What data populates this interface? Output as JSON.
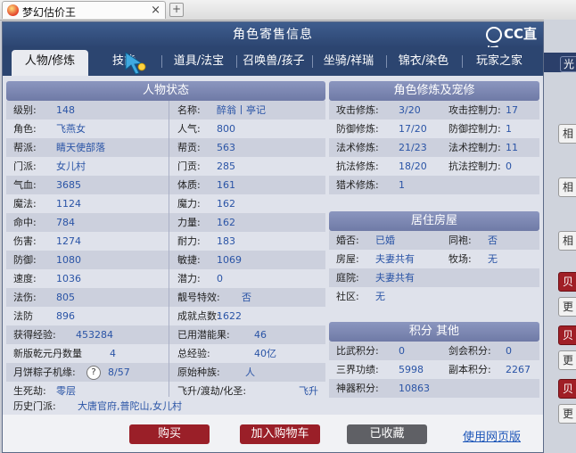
{
  "browser": {
    "tab_title": "梦幻估价王",
    "close": "×",
    "newtab": "+"
  },
  "dialog": {
    "title": "角色寄售信息",
    "logo": "CC直播"
  },
  "tabs": [
    "人物/修炼",
    "技能",
    "道具/法宝",
    "召唤兽/孩子",
    "坐骑/祥瑞",
    "锦衣/染色",
    "玩家之家"
  ],
  "sections": {
    "status": "人物状态",
    "cultivation": "角色修炼及宠修",
    "housing": "居住房屋",
    "points": "积分 其他"
  },
  "left_rows": [
    {
      "l1": "级别:",
      "v1": "148",
      "l2": "名称:",
      "v2": "醉翁丨亭记"
    },
    {
      "l1": "角色:",
      "v1": "飞燕女",
      "l2": "人气:",
      "v2": "800"
    },
    {
      "l1": "帮派:",
      "v1": "睛天使部落",
      "l2": "帮贡:",
      "v2": "563"
    },
    {
      "l1": "门派:",
      "v1": "女儿村",
      "l2": "门贡:",
      "v2": "285"
    },
    {
      "l1": "气血:",
      "v1": "3685",
      "l2": "体质:",
      "v2": "161"
    },
    {
      "l1": "魔法:",
      "v1": "1124",
      "l2": "魔力:",
      "v2": "162"
    },
    {
      "l1": "命中:",
      "v1": "784",
      "l2": "力量:",
      "v2": "162"
    },
    {
      "l1": "伤害:",
      "v1": "1274",
      "l2": "耐力:",
      "v2": "183"
    },
    {
      "l1": "防御:",
      "v1": "1080",
      "l2": "敏捷:",
      "v2": "1069"
    },
    {
      "l1": "速度:",
      "v1": "1036",
      "l2": "潜力:",
      "v2": "0"
    },
    {
      "l1": "法伤:",
      "v1": "805",
      "l2": "靓号特效:",
      "v2": "否"
    },
    {
      "l1": "法防",
      "v1": "896",
      "l2": "成就点数:",
      "v2": "1622"
    },
    {
      "l1": "获得经验:",
      "v1": "453284",
      "l2": "已用潜能果:",
      "v2": "46"
    },
    {
      "l1": "新版乾元丹数量",
      "v1": "4",
      "l2": "总经验:",
      "v2": "40亿"
    },
    {
      "l1": "月饼粽子机缘:",
      "v1": "8/57",
      "l2": "原始种族:",
      "v2": "人",
      "help": "?"
    },
    {
      "l1": "生死劫:",
      "v1": "零层",
      "l2": "飞升/渡劫/化圣:",
      "v2": "飞升"
    }
  ],
  "history": {
    "label": "历史门派:",
    "value": "大唐官府,普陀山,女儿村"
  },
  "cultivation_rows": [
    {
      "l1": "攻击修炼:",
      "v1": "3/20",
      "l2": "攻击控制力:",
      "v2": "17"
    },
    {
      "l1": "防御修炼:",
      "v1": "17/20",
      "l2": "防御控制力:",
      "v2": "1"
    },
    {
      "l1": "法术修炼:",
      "v1": "21/23",
      "l2": "法术控制力:",
      "v2": "11"
    },
    {
      "l1": "抗法修炼:",
      "v1": "18/20",
      "l2": "抗法控制力:",
      "v2": "0"
    },
    {
      "l1": "猎术修炼:",
      "v1": "1",
      "l2": "",
      "v2": ""
    }
  ],
  "housing_rows": [
    {
      "l1": "婚否:",
      "v1": "已婚",
      "l2": "同袍:",
      "v2": "否"
    },
    {
      "l1": "房屋:",
      "v1": "夫妻共有",
      "l2": "牧场:",
      "v2": "无"
    },
    {
      "l1": "庭院:",
      "v1": "夫妻共有",
      "l2": "",
      "v2": ""
    },
    {
      "l1": "社区:",
      "v1": "无",
      "l2": "",
      "v2": ""
    }
  ],
  "points_rows": [
    {
      "l1": "比武积分:",
      "v1": "0",
      "l2": "剑会积分:",
      "v2": "0"
    },
    {
      "l1": "三界功绩:",
      "v1": "5998",
      "l2": "副本积分:",
      "v2": "2267"
    },
    {
      "l1": "神器积分:",
      "v1": "10863",
      "l2": "",
      "v2": ""
    }
  ],
  "footer": {
    "buy": "购买",
    "cart": "加入购物车",
    "fav": "已收藏",
    "web": "使用网页版"
  },
  "side": {
    "top": "光",
    "b1": "相",
    "b2": "相",
    "b3": "相",
    "r1": "贝",
    "g1": "更",
    "r2": "贝",
    "g2": "更",
    "r3": "贝",
    "g3": "更"
  }
}
